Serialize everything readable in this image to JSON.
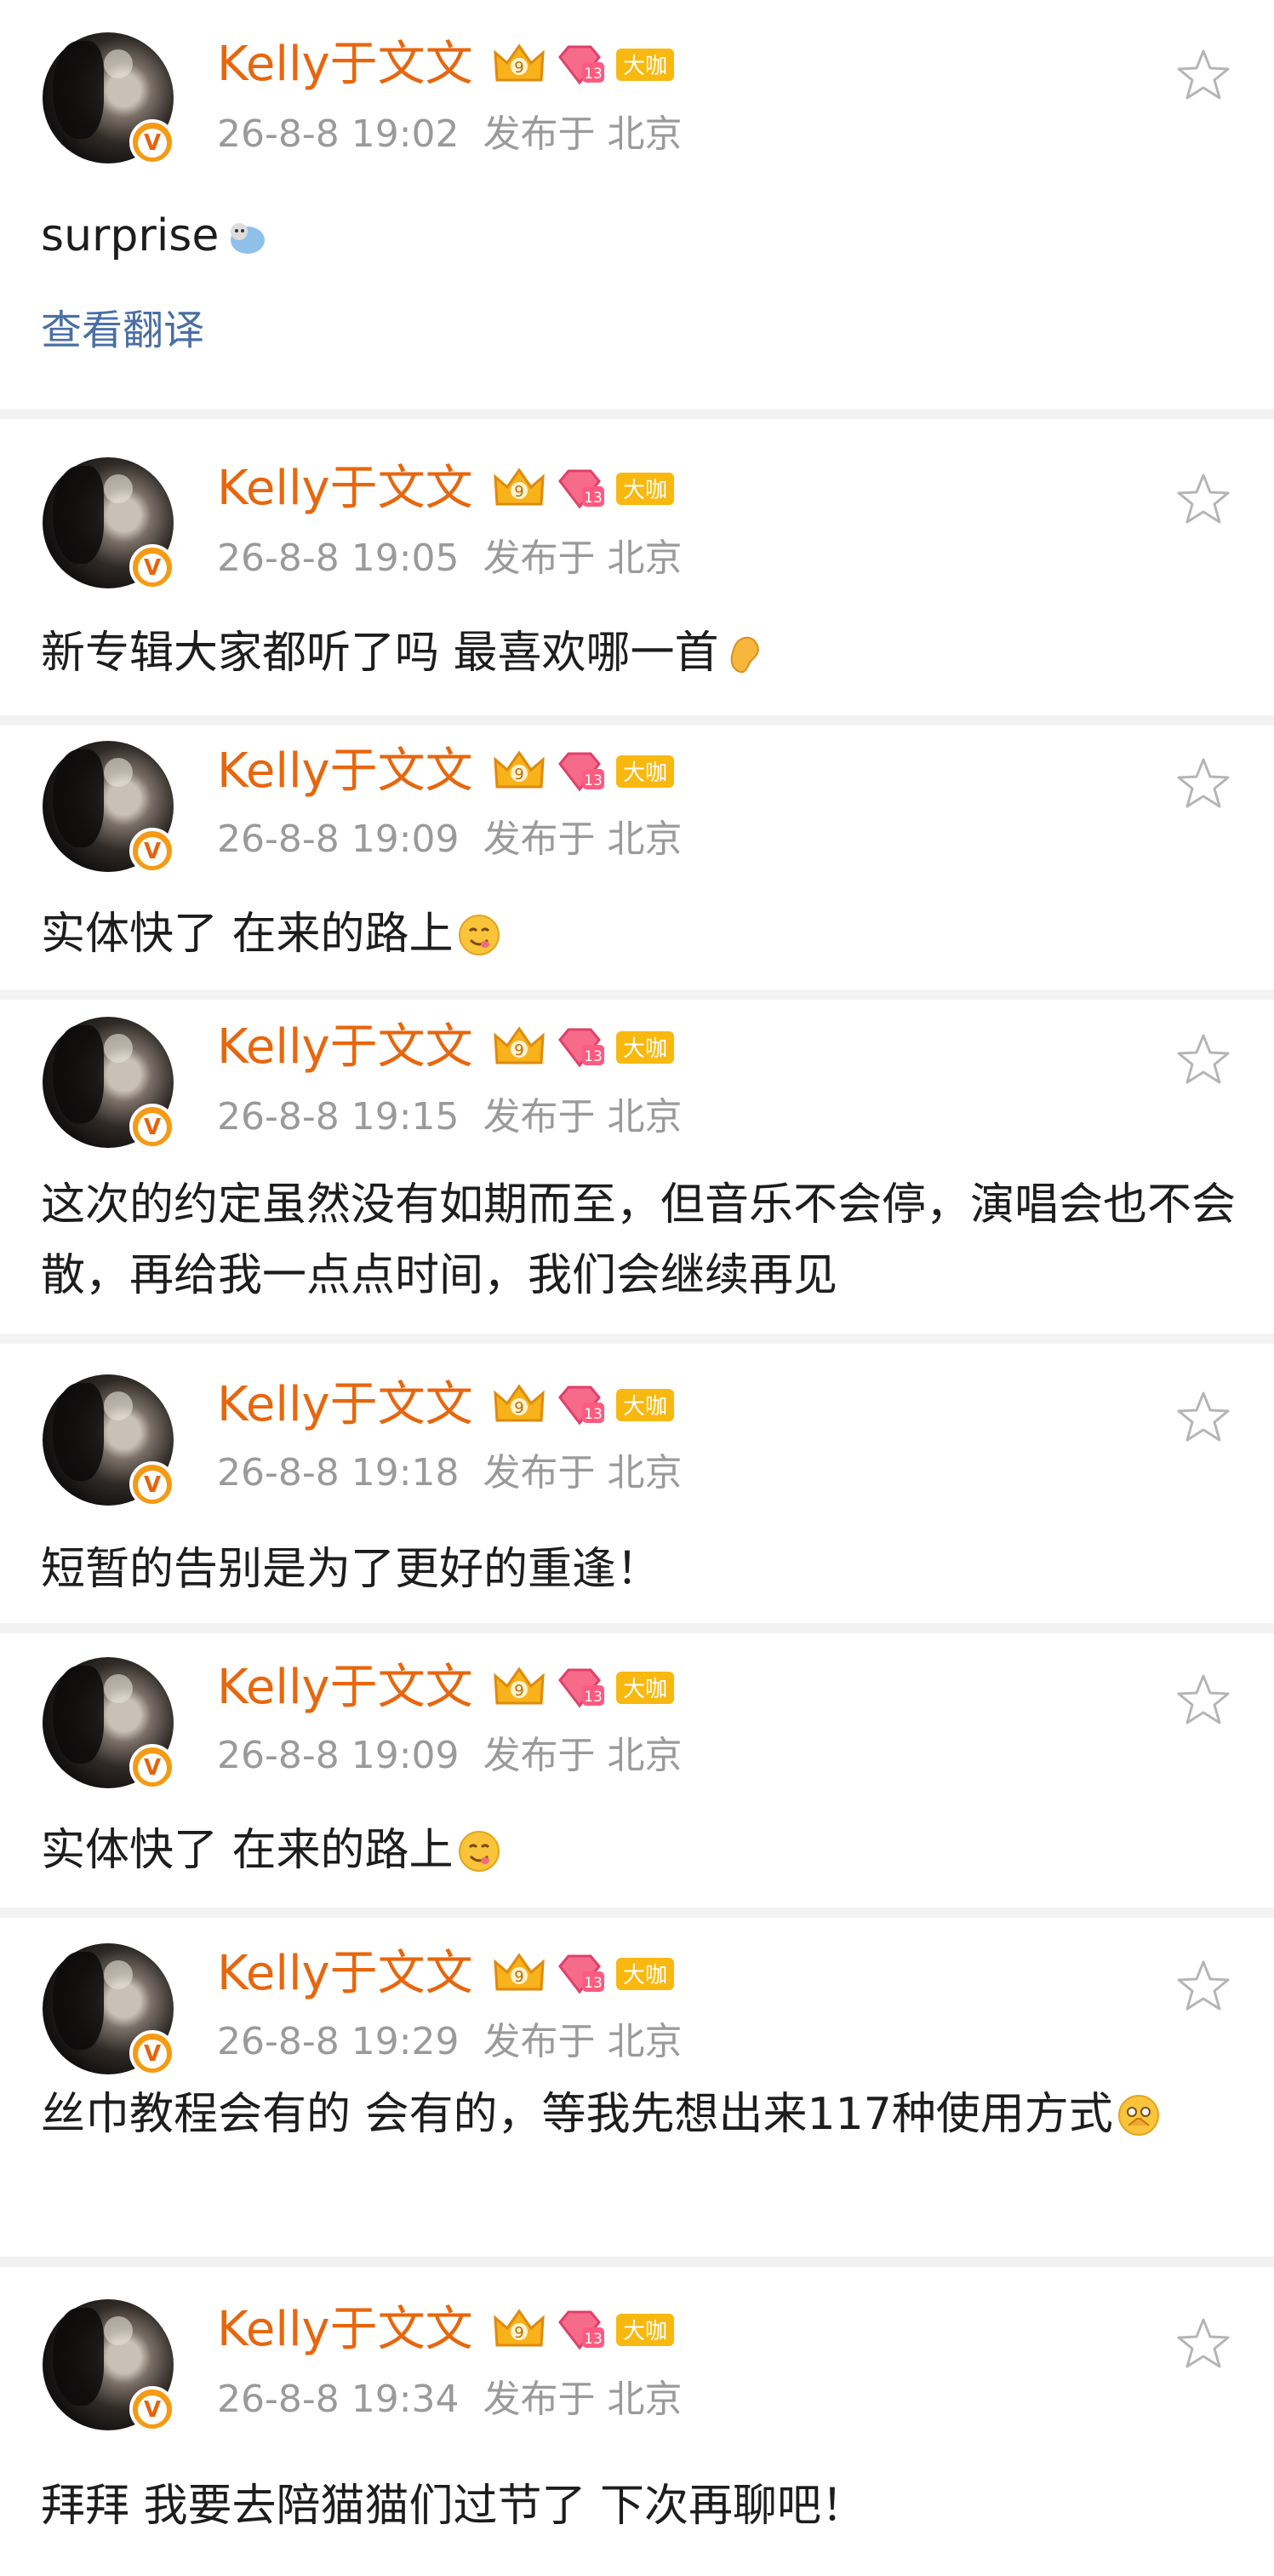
{
  "user": {
    "name": "Kelly于文文",
    "vip_label": "大咖",
    "gem_level": "13",
    "crown_level": "9",
    "verified_mark": "V"
  },
  "translate_label": "查看翻译",
  "colors": {
    "name": "#e8660d",
    "meta": "#9a9a9a",
    "vip_badge": "#f9b80f",
    "verified": "#f59a12",
    "link": "#4a6fa5",
    "separator": "#f2f2f2"
  },
  "posts": [
    {
      "time": "26-8-8 19:02",
      "location": "发布于 北京",
      "text": "surprise",
      "emoji": "cat-fish-emoji"
    },
    {
      "time": "26-8-8 19:05",
      "location": "发布于 北京",
      "text": "新专辑大家都听了吗 最喜欢哪一首",
      "emoji": "ear-emoji"
    },
    {
      "time": "26-8-8 19:09",
      "location": "发布于 北京",
      "text": "实体快了 在来的路上",
      "emoji": "yummy-face-emoji"
    },
    {
      "time": "26-8-8 19:15",
      "location": "发布于 北京",
      "text": "这次的约定虽然没有如期而至，但音乐不会停，演唱会也不会散，再给我一点点时间，我们会继续再见"
    },
    {
      "time": "26-8-8 19:18",
      "location": "发布于 北京",
      "text": "短暂的告别是为了更好的重逢！"
    },
    {
      "time": "26-8-8 19:09",
      "location": "发布于 北京",
      "text": "实体快了 在来的路上",
      "emoji": "yummy-face-emoji"
    },
    {
      "time": "26-8-8 19:29",
      "location": "发布于 北京",
      "text": "丝巾教程会有的 会有的，等我先想出来117种使用方式",
      "emoji": "pleading-face-emoji"
    },
    {
      "time": "26-8-8 19:34",
      "location": "发布于 北京",
      "text": "拜拜 我要去陪猫猫们过节了 下次再聊吧！"
    }
  ]
}
